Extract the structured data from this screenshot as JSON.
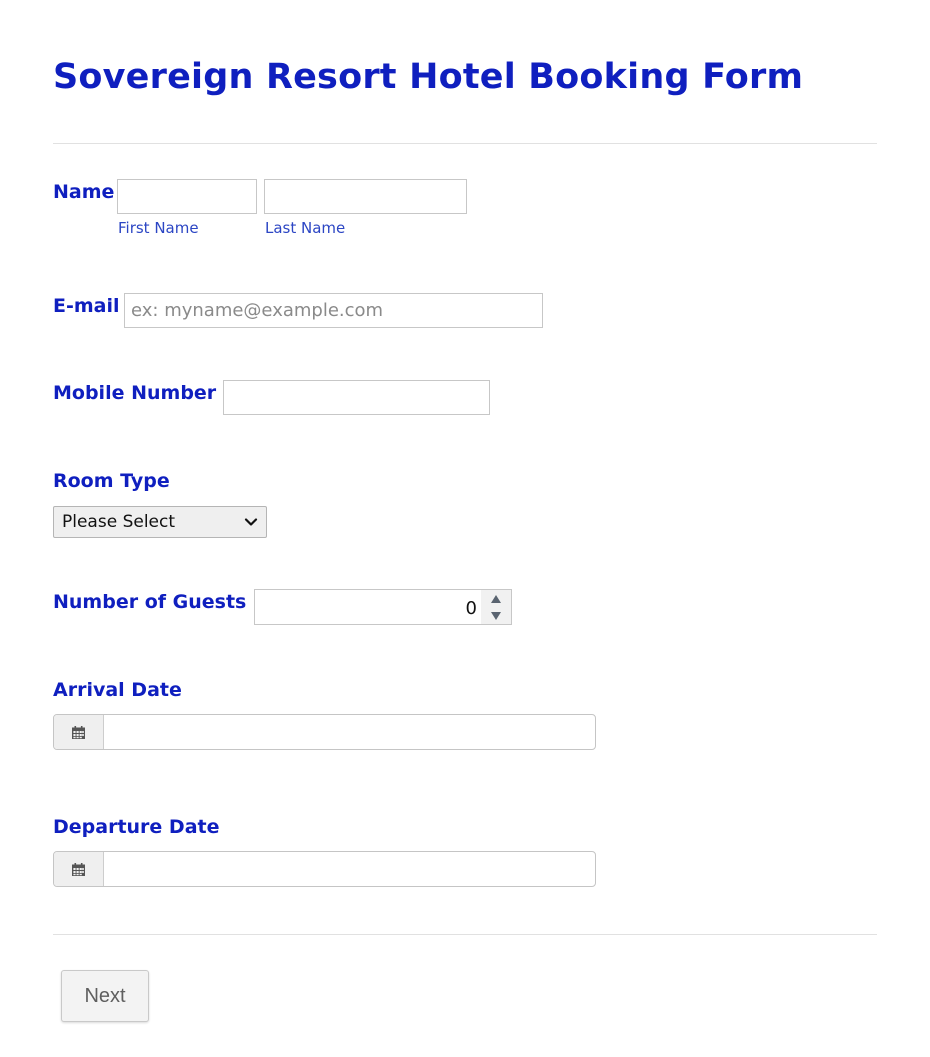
{
  "form": {
    "title": "Sovereign Resort Hotel Booking Form"
  },
  "name": {
    "label": "Name",
    "first_sublabel": "First Name",
    "last_sublabel": "Last Name",
    "first_value": "",
    "last_value": ""
  },
  "email": {
    "label": "E-mail",
    "placeholder": "ex: myname@example.com",
    "value": ""
  },
  "mobile": {
    "label": "Mobile Number",
    "value": ""
  },
  "room_type": {
    "label": "Room Type",
    "selected": "Please Select"
  },
  "guests": {
    "label": "Number of Guests",
    "value": "0"
  },
  "arrival": {
    "label": "Arrival Date",
    "value": "",
    "icon": "calendar-icon"
  },
  "departure": {
    "label": "Departure Date",
    "value": "",
    "icon": "calendar-icon"
  },
  "actions": {
    "next_label": "Next"
  },
  "colors": {
    "heading": "#0f1fbf",
    "sublabel": "#2c46c4",
    "divider": "#e1e1e1"
  }
}
